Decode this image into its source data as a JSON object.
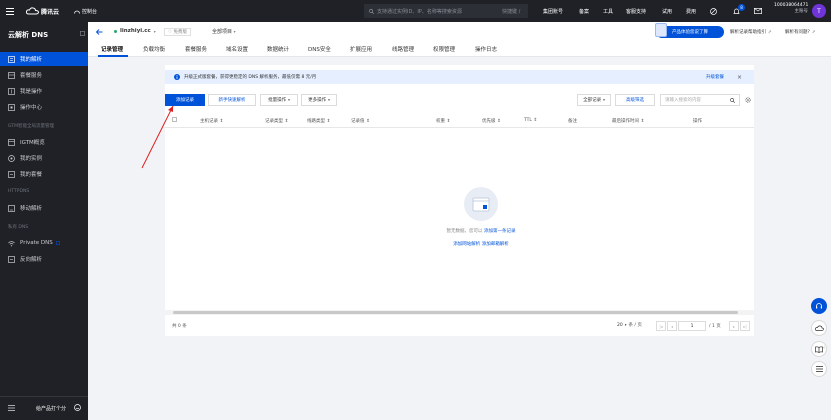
{
  "topbar": {
    "brand": "腾讯云",
    "console": "控制台",
    "search_placeholder": "支持通过实例ID、IP、名称等搜索资源",
    "shortcut": "快捷键 /",
    "nav": [
      "集团账号",
      "备案",
      "工具",
      "客服支持",
      "试用",
      "费用"
    ],
    "badge": "8",
    "account_id": "100038064471",
    "account_type": "主账号",
    "avatar": "T"
  },
  "sidebar": {
    "title": "云解析 DNS",
    "items_a": [
      "我的解析",
      "套餐服务",
      "我是操作",
      "操作中心"
    ],
    "section_gtm": "GTM智能全局流量管理",
    "items_b": [
      "IGTM概览",
      "我的实例",
      "我的套餐"
    ],
    "section_https": "HTTPDNS",
    "item_mobile": "移动解析",
    "section_private": "私有 DNS",
    "item_private": "Private DNS",
    "item_reverse": "反向解析",
    "footer": "给产品打个分"
  },
  "subheader": {
    "domain": "linzhiyi.cc",
    "domain_status": "免费版",
    "project": "全部项目",
    "promo": "产品体验您说了算",
    "links": [
      "解析记录帮助指引",
      "解析有问题?"
    ],
    "tabs": [
      "记录管理",
      "负载均衡",
      "套餐服务",
      "域名设置",
      "数据统计",
      "DNS安全",
      "扩展应用",
      "线路管理",
      "权限管理",
      "操作日志"
    ]
  },
  "notice": {
    "text": "升级正式版套餐，获得更稳定的 DNS 解析服务，最低仅需 8 元/月",
    "link": "升级套餐"
  },
  "toolbar": {
    "add": "添加记录",
    "quick": "新手快速解析",
    "batch": "批量操作",
    "more": "更多操作",
    "filter_all": "全部记录",
    "advanced": "高级筛选",
    "search_placeholder": "请输入搜索的内容"
  },
  "columns": [
    "主机记录",
    "记录类型",
    "线路类型",
    "记录值",
    "权重",
    "优先级",
    "TTL",
    "备注",
    "最后操作时间",
    "操作"
  ],
  "empty": {
    "text": "暂无数据，您可以",
    "link1": "添加第一条记录",
    "link2": "添加网站解析",
    "link3": "添加邮箱解析"
  },
  "footer": {
    "total": "共 0 条",
    "page_size": "20",
    "page_size_unit": "条 / 页",
    "page": "1",
    "page_total": "/ 1 页"
  },
  "colors": {
    "primary": "#0052d9",
    "dark": "#1f2127",
    "notice_bg": "#e5efff"
  }
}
